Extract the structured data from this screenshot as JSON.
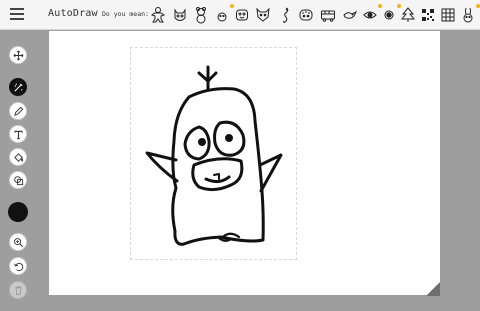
{
  "app": {
    "title": "AutoDraw"
  },
  "header": {
    "menu_icon": "hamburger-menu-icon",
    "suggest_label": "Do you mean:"
  },
  "suggestions": [
    {
      "name": "gingerbread-man",
      "is_new": false
    },
    {
      "name": "cat-face",
      "is_new": false
    },
    {
      "name": "teddy-bear",
      "is_new": false
    },
    {
      "name": "dog-face",
      "is_new": true
    },
    {
      "name": "bear-face",
      "is_new": false
    },
    {
      "name": "fox-face",
      "is_new": false
    },
    {
      "name": "seahorse",
      "is_new": false
    },
    {
      "name": "tiger-face",
      "is_new": false
    },
    {
      "name": "bus",
      "is_new": false
    },
    {
      "name": "bird",
      "is_new": false
    },
    {
      "name": "eye",
      "is_new": true
    },
    {
      "name": "eye-dark",
      "is_new": true
    },
    {
      "name": "tree",
      "is_new": false
    },
    {
      "name": "qr-pattern",
      "is_new": false
    },
    {
      "name": "grid-pattern",
      "is_new": false
    },
    {
      "name": "rabbit",
      "is_new": true
    }
  ],
  "tools": [
    {
      "name": "move-icon",
      "state": "normal"
    },
    {
      "name": "autodraw-icon",
      "state": "active"
    },
    {
      "name": "draw-icon",
      "state": "normal"
    },
    {
      "name": "type-icon",
      "state": "normal"
    },
    {
      "name": "fill-icon",
      "state": "normal"
    },
    {
      "name": "shape-icon",
      "state": "normal"
    },
    {
      "name": "zoom-icon",
      "state": "normal"
    },
    {
      "name": "undo-icon",
      "state": "normal"
    },
    {
      "name": "delete-icon",
      "state": "disabled"
    }
  ],
  "colors": {
    "current": "#111111",
    "accent_new": "#f7b21a",
    "canvas_bg": "#ffffff",
    "app_bg": "#9e9e9e"
  },
  "canvas": {
    "content": "hand-drawn penguin-like creature"
  }
}
